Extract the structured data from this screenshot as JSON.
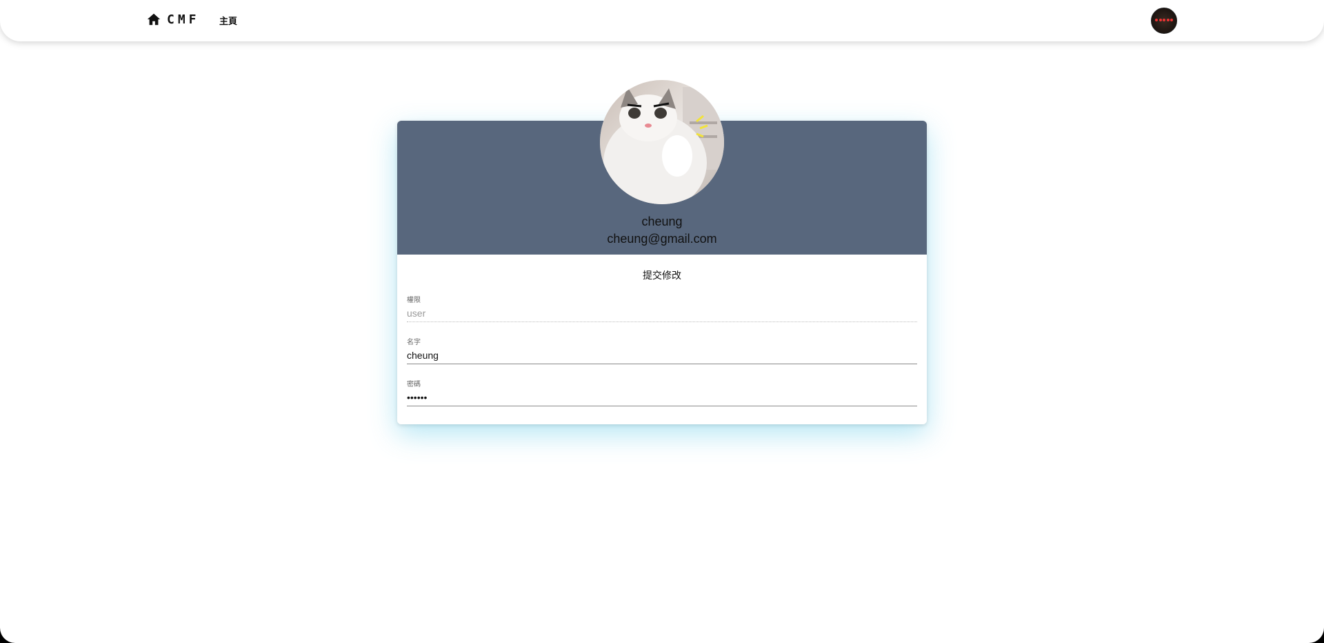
{
  "header": {
    "brand": "CMF",
    "nav_home": "主頁"
  },
  "profile": {
    "name": "cheung",
    "email": "cheung@gmail.com"
  },
  "form": {
    "submit_label": "提交修改",
    "role_label": "權限",
    "role_value": "user",
    "name_label": "名字",
    "name_value": "cheung",
    "password_label": "密碼",
    "password_value": "••••••"
  },
  "colors": {
    "card_header": "#58677d",
    "card_glow": "#5ac8e6"
  },
  "icons": {
    "brand": "home-icon"
  }
}
